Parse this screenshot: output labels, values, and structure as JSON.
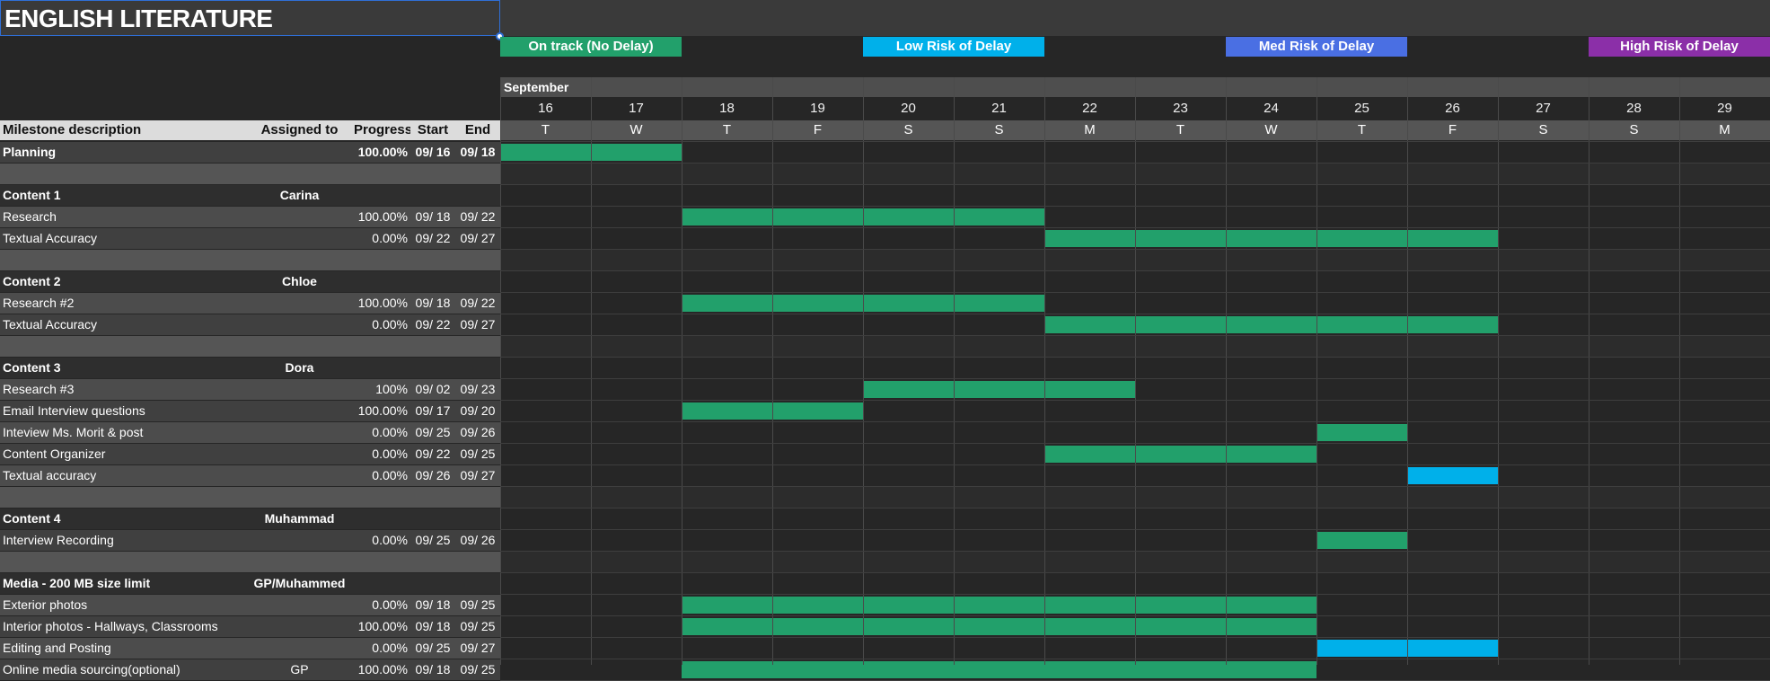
{
  "sheet_title": "ENGLISH LITERATURE",
  "legend": [
    {
      "label": "On track (No Delay)",
      "color": "#22a06b"
    },
    {
      "label": "Low Risk of Delay",
      "color": "#00b0ea"
    },
    {
      "label": "Med Risk of Delay",
      "color": "#4a6fe3"
    },
    {
      "label": "High Risk of Delay",
      "color": "#8b2fa8"
    }
  ],
  "month": "September",
  "dates": [
    "16",
    "17",
    "18",
    "19",
    "20",
    "21",
    "22",
    "23",
    "24",
    "25",
    "26",
    "27",
    "28",
    "29"
  ],
  "weekdays": [
    "T",
    "W",
    "T",
    "F",
    "S",
    "S",
    "M",
    "T",
    "W",
    "T",
    "F",
    "S",
    "S",
    "M"
  ],
  "headers": {
    "description": "Milestone description",
    "assigned": "Assigned to",
    "progress": "Progress",
    "start": "Start",
    "end": "End"
  },
  "rows": [
    {
      "kind": "task-bold",
      "desc": "Planning",
      "assigned": "",
      "progress": "100.00%",
      "start": "09/ 16",
      "end": "09/ 18",
      "bars": [
        {
          "from": 0,
          "to": 2,
          "status": "on-track"
        }
      ]
    },
    {
      "kind": "spacer"
    },
    {
      "kind": "group",
      "desc": "Content 1",
      "assigned": "Carina"
    },
    {
      "kind": "task",
      "desc": "Research",
      "assigned": "",
      "progress": "100.00%",
      "start": "09/ 18",
      "end": "09/ 22",
      "bars": [
        {
          "from": 2,
          "to": 6,
          "status": "on-track"
        }
      ]
    },
    {
      "kind": "task",
      "desc": "Textual Accuracy",
      "assigned": "",
      "progress": "0.00%",
      "start": "09/ 22",
      "end": "09/ 27",
      "bars": [
        {
          "from": 6,
          "to": 11,
          "status": "on-track"
        }
      ]
    },
    {
      "kind": "spacer"
    },
    {
      "kind": "group",
      "desc": "Content 2",
      "assigned": "Chloe"
    },
    {
      "kind": "task",
      "desc": "Research #2",
      "assigned": "",
      "progress": "100.00%",
      "start": "09/ 18",
      "end": "09/ 22",
      "bars": [
        {
          "from": 2,
          "to": 6,
          "status": "on-track"
        }
      ]
    },
    {
      "kind": "task",
      "desc": "Textual Accuracy",
      "assigned": "",
      "progress": "0.00%",
      "start": "09/ 22",
      "end": "09/ 27",
      "bars": [
        {
          "from": 6,
          "to": 11,
          "status": "on-track"
        }
      ]
    },
    {
      "kind": "spacer"
    },
    {
      "kind": "group",
      "desc": "Content 3",
      "assigned": "Dora"
    },
    {
      "kind": "task",
      "desc": "Research #3",
      "assigned": "",
      "progress": "100%",
      "start": "09/ 02",
      "end": "09/ 23",
      "bars": [
        {
          "from": 4,
          "to": 7,
          "status": "on-track"
        }
      ]
    },
    {
      "kind": "task",
      "desc": "Email Interview questions",
      "assigned": "",
      "progress": "100.00%",
      "start": "09/ 17",
      "end": "09/ 20",
      "bars": [
        {
          "from": 2,
          "to": 4,
          "status": "on-track"
        }
      ]
    },
    {
      "kind": "task",
      "desc": "Inteview Ms. Morit & post",
      "assigned": "",
      "progress": "0.00%",
      "start": "09/ 25",
      "end": "09/ 26",
      "bars": [
        {
          "from": 9,
          "to": 10,
          "status": "on-track"
        }
      ]
    },
    {
      "kind": "task",
      "desc": "Content Organizer",
      "assigned": "",
      "progress": "0.00%",
      "start": "09/ 22",
      "end": "09/ 25",
      "bars": [
        {
          "from": 6,
          "to": 9,
          "status": "on-track"
        }
      ]
    },
    {
      "kind": "task",
      "desc": "Textual accuracy",
      "assigned": "",
      "progress": "0.00%",
      "start": "09/ 26",
      "end": "09/ 27",
      "bars": [
        {
          "from": 10,
          "to": 11,
          "status": "low-risk"
        }
      ]
    },
    {
      "kind": "spacer"
    },
    {
      "kind": "group",
      "desc": "Content 4",
      "assigned": "Muhammad"
    },
    {
      "kind": "task",
      "desc": "Interview Recording",
      "assigned": "",
      "progress": "0.00%",
      "start": "09/ 25",
      "end": "09/ 26",
      "bars": [
        {
          "from": 9,
          "to": 10,
          "status": "on-track"
        }
      ]
    },
    {
      "kind": "spacer"
    },
    {
      "kind": "group",
      "desc": "Media - 200 MB size limit",
      "assigned": "GP/Muhammed"
    },
    {
      "kind": "task",
      "desc": "Exterior photos",
      "assigned": "",
      "progress": "0.00%",
      "start": "09/ 18",
      "end": "09/ 25",
      "bars": [
        {
          "from": 2,
          "to": 9,
          "status": "on-track"
        }
      ]
    },
    {
      "kind": "task",
      "desc": "Interior photos - Hallways, Classrooms",
      "assigned": "",
      "progress": "100.00%",
      "start": "09/ 18",
      "end": "09/ 25",
      "bars": [
        {
          "from": 2,
          "to": 9,
          "status": "on-track"
        }
      ]
    },
    {
      "kind": "task",
      "desc": "Editing and Posting",
      "assigned": "",
      "progress": "0.00%",
      "start": "09/ 25",
      "end": "09/ 27",
      "bars": [
        {
          "from": 9,
          "to": 11,
          "status": "low-risk"
        }
      ]
    },
    {
      "kind": "task",
      "desc": "Online media sourcing(optional)",
      "assigned": "GP",
      "progress": "100.00%",
      "start": "09/ 18",
      "end": "09/ 25",
      "bars": [
        {
          "from": 2,
          "to": 9,
          "status": "on-track"
        }
      ]
    }
  ],
  "status_colors": {
    "on-track": "#22a06b",
    "low-risk": "#00b0ea",
    "med-risk": "#4a6fe3",
    "high-risk": "#8b2fa8"
  }
}
